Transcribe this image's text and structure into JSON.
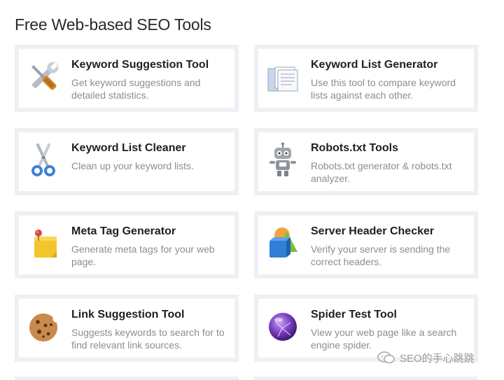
{
  "page": {
    "title": "Free Web-based SEO Tools"
  },
  "tools": [
    {
      "title": "Keyword Suggestion Tool",
      "description": "Get keyword suggestions and detailed statistics.",
      "icon": "wrench-screwdriver-icon"
    },
    {
      "title": "Keyword List Generator",
      "description": "Use this tool to compare keyword lists against each other.",
      "icon": "folder-documents-icon"
    },
    {
      "title": "Keyword List Cleaner",
      "description": "Clean up your keyword lists.",
      "icon": "scissors-icon"
    },
    {
      "title": "Robots.txt Tools",
      "description": "Robots.txt generator & robots.txt analyzer.",
      "icon": "robot-icon"
    },
    {
      "title": "Meta Tag Generator",
      "description": "Generate meta tags for your web page.",
      "icon": "sticky-note-pin-icon"
    },
    {
      "title": "Server Header Checker",
      "description": "Verify your server is sending the correct headers.",
      "icon": "shapes-icon"
    },
    {
      "title": "Link Suggestion Tool",
      "description": "Suggests keywords to search for to find relevant link sources.",
      "icon": "cookie-icon"
    },
    {
      "title": "Spider Test Tool",
      "description": "View your web page like a search engine spider.",
      "icon": "purple-orb-icon"
    }
  ],
  "watermark": {
    "text": "SEO的手心跳跳",
    "icon": "wechat-icon"
  }
}
